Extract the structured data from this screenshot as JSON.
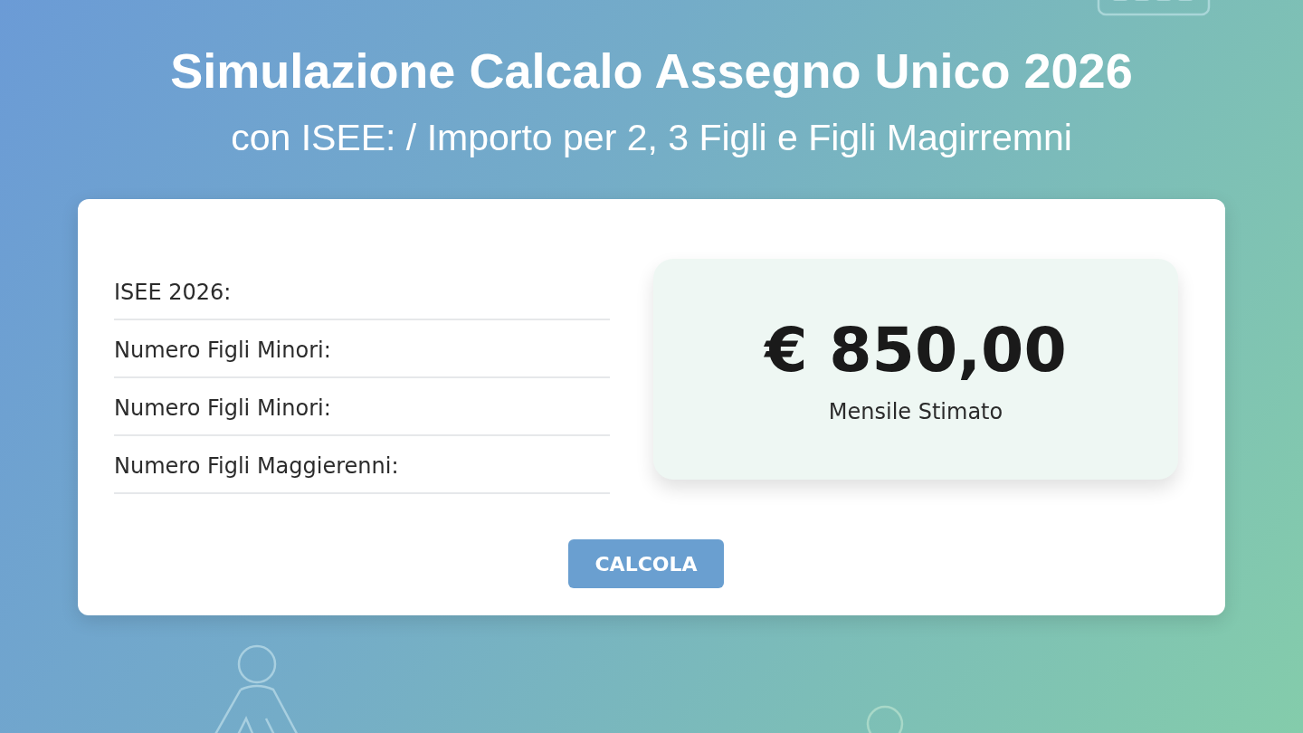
{
  "header": {
    "title": "Simulazione Calcalo Assegno Unico 2026",
    "subtitle": "con ISEE: / Importo per 2, 3 Figli e Figli Magirremni"
  },
  "form": {
    "fields": [
      {
        "label": "ISEE 2026:"
      },
      {
        "label": "Numero Figli Minori:"
      },
      {
        "label": "Numero Figli Minori:"
      },
      {
        "label": "Numero Figli Maggierenni:"
      }
    ],
    "result": {
      "amount": "€ 850,00",
      "caption": "Mensile Stimato"
    },
    "button": "CALCOLA"
  }
}
